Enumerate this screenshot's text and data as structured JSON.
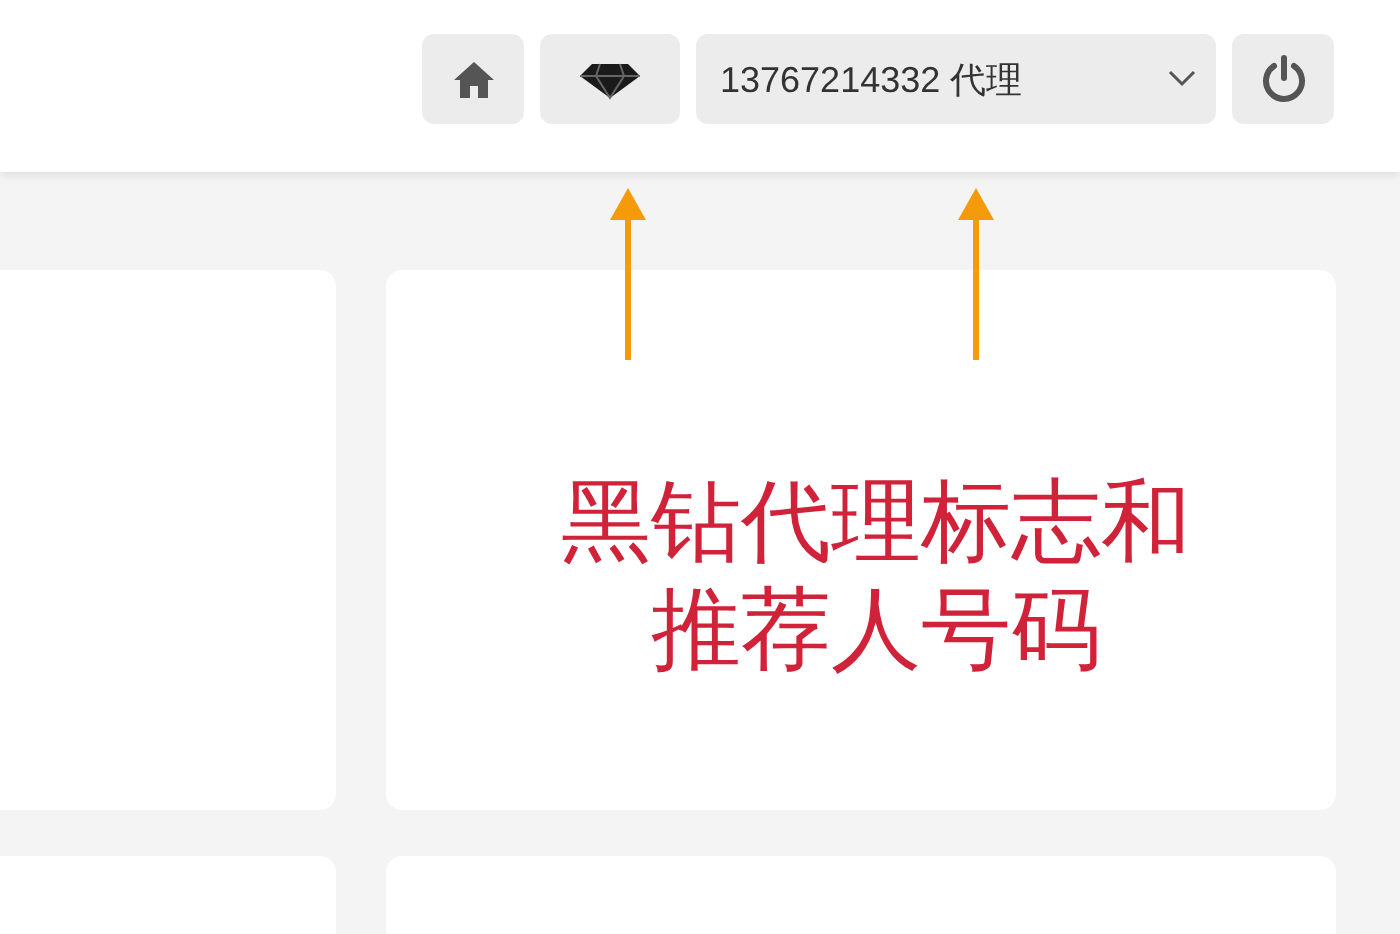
{
  "header": {
    "account": {
      "label": "13767214332 代理"
    }
  },
  "annotation": {
    "text": "黑钻代理标志和推荐人号码",
    "arrows": [
      {
        "kind": "arrow"
      },
      {
        "kind": "arrow"
      }
    ]
  }
}
